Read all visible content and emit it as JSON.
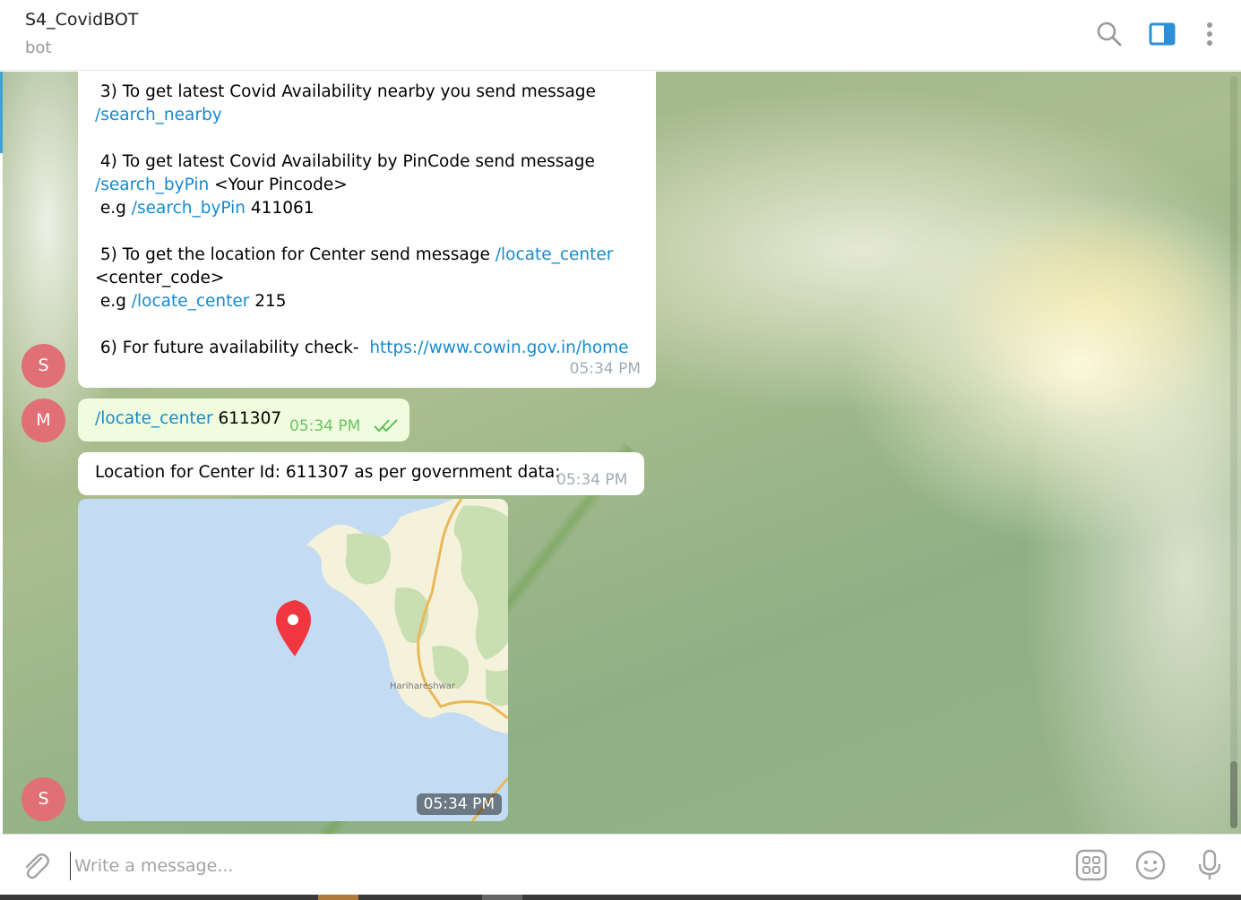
{
  "header": {
    "title": "S4_CovidBOT",
    "subtitle": "bot",
    "icons": [
      "search-icon",
      "sidebar-toggle-icon",
      "more-vertical-icon"
    ]
  },
  "messages": {
    "m1": {
      "avatar": "S",
      "l1": " 3) To get latest Covid Availability nearby you send message",
      "l2_link": "/search_nearby",
      "l3": " 4) To get latest Covid Availability by PinCode send message",
      "l4_link": "/search_byPin",
      "l4_text": " <Your Pincode>",
      "l5_pre": " e.g ",
      "l5_link": "/search_byPin",
      "l5_text": " 411061",
      "l6": " 5) To get the location for Center send message ",
      "l6_link": "/locate_center",
      "l7": "<center_code>",
      "l8_pre": " e.g ",
      "l8_link": "/locate_center",
      "l8_text": " 215",
      "l9": " 6) For future availability check-  ",
      "l9_link": "https://www.cowin.gov.in/home",
      "time": "05:34 PM"
    },
    "m2": {
      "avatar": "M",
      "link": "/locate_center",
      "text": " 611307",
      "time": "05:34 PM",
      "status_icon": "double-check-icon"
    },
    "m3": {
      "text": "Location for Center Id: 611307 as per government data:",
      "time": "05:34 PM"
    },
    "m4": {
      "avatar": "S",
      "map_label": "Harihareshwar",
      "time": "05:34 PM"
    }
  },
  "composer": {
    "placeholder": "Write a message...",
    "icons": [
      "attach-icon",
      "bot-commands-icon",
      "emoji-icon",
      "microphone-icon"
    ]
  },
  "colors": {
    "link": "#168acd",
    "avatar_bg": "#e17076",
    "outgoing_bg": "#effdde",
    "outgoing_time": "#6cc264",
    "accent": "#419fd9"
  }
}
